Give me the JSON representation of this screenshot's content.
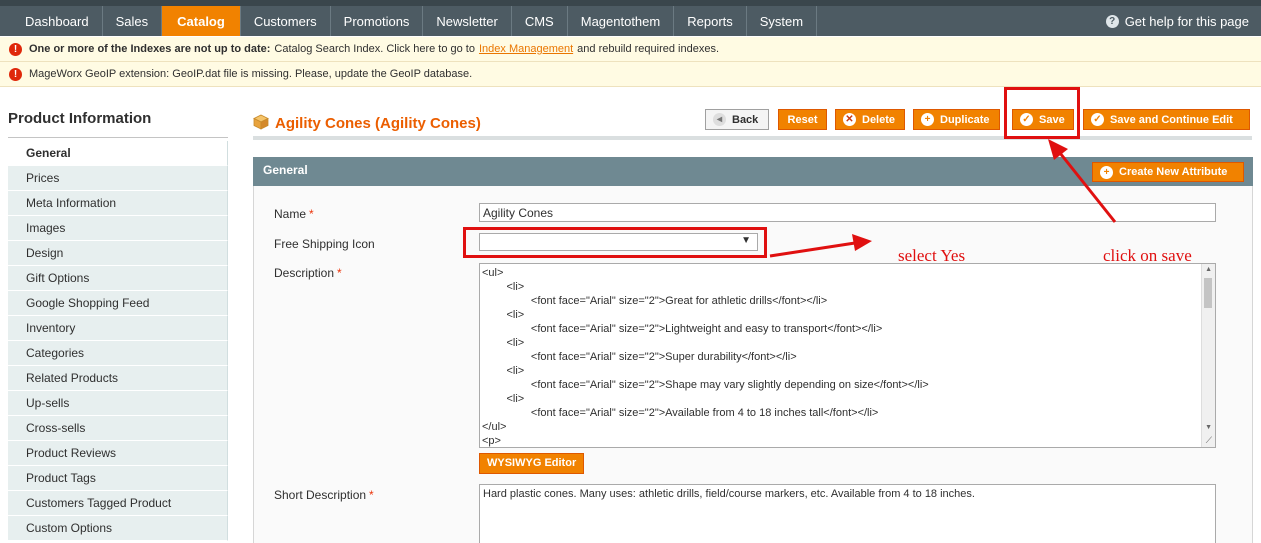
{
  "nav": {
    "items": [
      "Dashboard",
      "Sales",
      "Catalog",
      "Customers",
      "Promotions",
      "Newsletter",
      "CMS",
      "Magentothem",
      "Reports",
      "System"
    ],
    "active": "Catalog",
    "help": "Get help for this page"
  },
  "messages": {
    "index_bold": "One or more of the Indexes are not up to date:",
    "index_text": "Catalog Search Index. Click here to go to",
    "index_link": "Index Management",
    "index_tail": "and rebuild required indexes.",
    "geoip": "MageWorx GeoIP extension: GeoIP.dat file is missing. Please, update the GeoIP database."
  },
  "sidebar": {
    "title": "Product Information",
    "items": [
      "General",
      "Prices",
      "Meta Information",
      "Images",
      "Design",
      "Gift Options",
      "Google Shopping Feed",
      "Inventory",
      "Categories",
      "Related Products",
      "Up-sells",
      "Cross-sells",
      "Product Reviews",
      "Product Tags",
      "Customers Tagged Product",
      "Custom Options"
    ]
  },
  "header": {
    "title": "Agility Cones (Agility Cones)",
    "buttons": {
      "back": "Back",
      "reset": "Reset",
      "delete": "Delete",
      "duplicate": "Duplicate",
      "save": "Save",
      "save_continue": "Save and Continue Edit"
    }
  },
  "fieldset": {
    "title": "General",
    "create_attribute": "Create New Attribute",
    "name_label": "Name",
    "name_value": "Agility Cones",
    "shipping_label": "Free Shipping Icon",
    "shipping_value": "",
    "description_label": "Description",
    "description_lines": [
      "<ul>",
      "        <li>",
      "                <font face=\"Arial\" size=\"2\">Great for athletic drills</font></li>",
      "        <li>",
      "                <font face=\"Arial\" size=\"2\">Lightweight and easy to transport</font></li>",
      "        <li>",
      "                <font face=\"Arial\" size=\"2\">Super durability</font></li>",
      "        <li>",
      "                <font face=\"Arial\" size=\"2\">Shape may vary slightly depending on size</font></li>",
      "        <li>",
      "                <font face=\"Arial\" size=\"2\">Available from 4 to 18 inches tall</font></li>",
      "</ul>",
      "<p>"
    ],
    "wysiwyg": "WYSIWYG Editor",
    "short_label": "Short Description",
    "short_value": "Hard plastic cones. Many uses: athletic drills, field/course markers, etc. Available from 4 to 18 inches."
  },
  "annotations": {
    "select_yes": "select Yes",
    "click_save": "click on save"
  },
  "colors": {
    "accent": "#f18200",
    "nav_bg": "#4d5b63",
    "annotation": "#e01010"
  }
}
